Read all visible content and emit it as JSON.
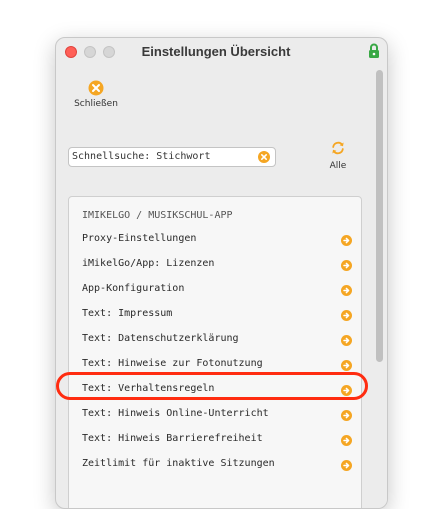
{
  "window": {
    "title": "Einstellungen Übersicht",
    "icons": {
      "close_light": "close-light",
      "minimize_light": "minimize-light",
      "zoom_light": "zoom-light",
      "lock": "lock-icon"
    }
  },
  "toolbar": {
    "close_label": "Schließen",
    "close_icon": "close-circle-icon"
  },
  "search": {
    "value": "Schnellsuche: Stichwort",
    "clear_icon": "clear-circle-icon"
  },
  "all_button": {
    "label": "Alle",
    "icon": "refresh-icon"
  },
  "panel": {
    "section_title": "IMIKELGO / MUSIKSCHUL-APP",
    "items": [
      {
        "label": "Proxy-Einstellungen"
      },
      {
        "label": "iMikelGo/App: Lizenzen"
      },
      {
        "label": "App-Konfiguration"
      },
      {
        "label": "Text: Impressum"
      },
      {
        "label": "Text: Datenschutzerklärung"
      },
      {
        "label": "Text: Hinweise zur Fotonutzung"
      },
      {
        "label": "Text: Verhaltensregeln",
        "highlighted": true
      },
      {
        "label": "Text: Hinweis Online-Unterricht"
      },
      {
        "label": "Text: Hinweis Barrierefreiheit"
      },
      {
        "label": "Zeitlimit für inaktive Sitzungen"
      }
    ]
  },
  "colors": {
    "accent": "#f5a623",
    "highlight": "#ff2c10",
    "close_light": "#ff5f57",
    "lock": "#39a845"
  }
}
